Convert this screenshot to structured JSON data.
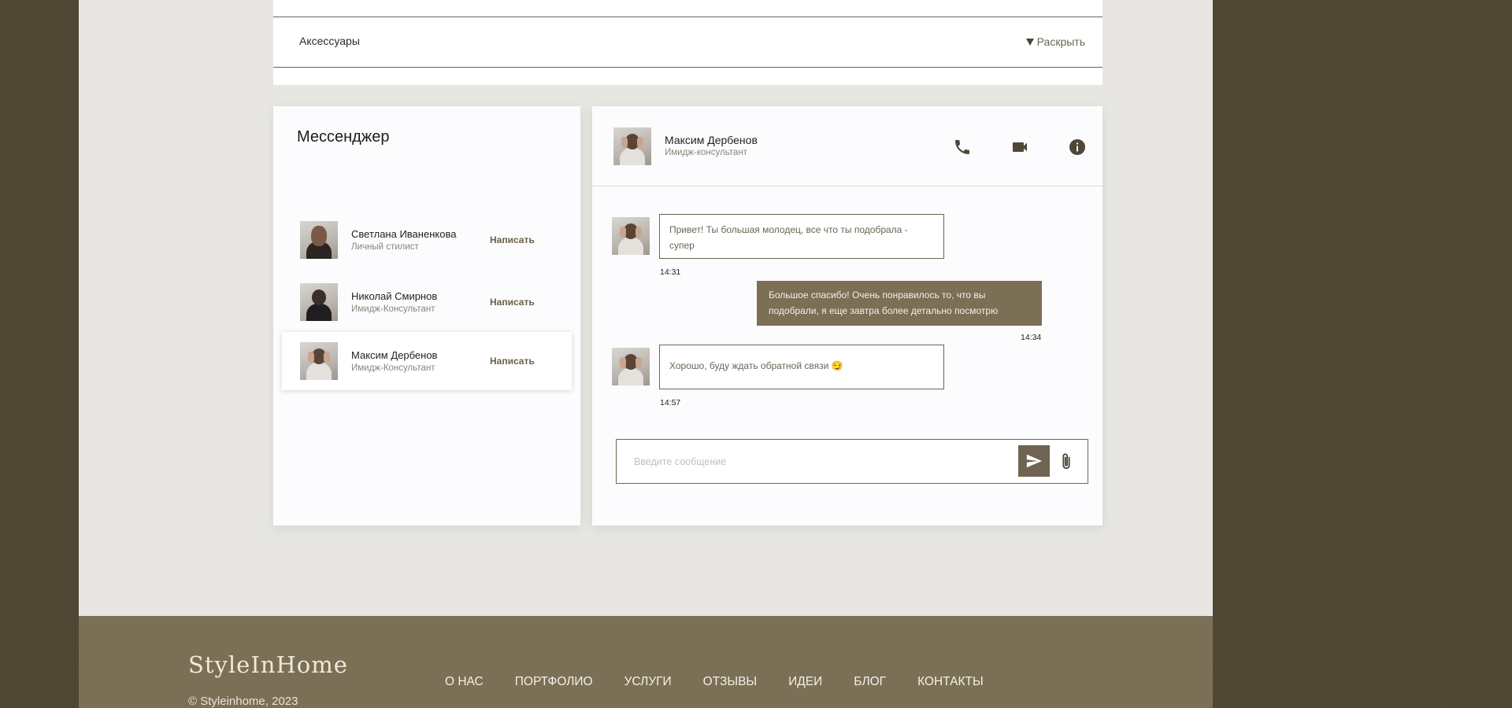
{
  "accordion": {
    "label": "Аксессуары",
    "toggle_label": "Раскрыть"
  },
  "messenger": {
    "title": "Мессенджер",
    "contacts": [
      {
        "name": "Светлана Иваненкова",
        "role": "Личный стилист",
        "action": "Написать"
      },
      {
        "name": "Николай Смирнов",
        "role": "Имидж-Консультант",
        "action": "Написать"
      },
      {
        "name": "Максим Дербенов",
        "role": "Имидж-Консультант",
        "action": "Написать",
        "active": true
      }
    ]
  },
  "chat": {
    "header": {
      "name": "Максим Дербенов",
      "role": "Имидж-консультант",
      "icons": [
        "phone-icon",
        "video-camera-icon",
        "info-icon"
      ]
    },
    "messages": [
      {
        "direction": "incoming",
        "text": "Привет! Ты большая молодец, все что ты подобрала - супер",
        "time": "14:31"
      },
      {
        "direction": "outgoing",
        "text": "Большое спасибо! Очень понравилось то, что вы подобрали, я еще завтра более детально посмотрю",
        "time": "14:34"
      },
      {
        "direction": "incoming",
        "text": "Хорошо, буду ждать обратной связи 😏",
        "time": "14:57"
      }
    ],
    "composer": {
      "placeholder": "Введите сообщение",
      "value": ""
    }
  },
  "footer": {
    "logo": "StyleInHome",
    "copyright": "© Styleinhome, 2023",
    "nav": [
      "О НАС",
      "ПОРТФОЛИО",
      "УСЛУГИ",
      "ОТЗЫВЫ",
      "ИДЕИ",
      "БЛОГ",
      "КОНТАКТЫ"
    ]
  },
  "colors": {
    "accent": "#7b6f55",
    "border": "#6e6451",
    "background_outer": "#4e4633",
    "page": "#e7e6e2"
  }
}
